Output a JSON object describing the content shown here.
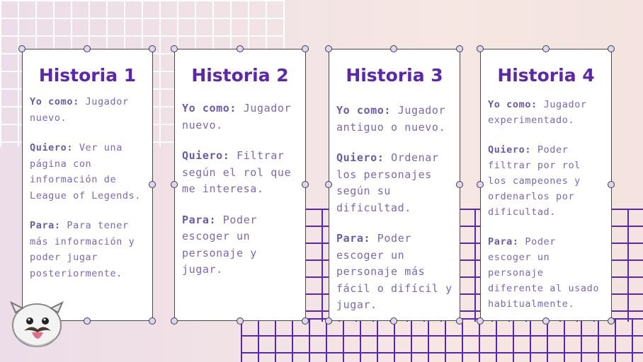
{
  "cards": [
    {
      "title": "Historia 1",
      "yo_label": "Yo como:",
      "yo_text": "Jugador nuevo.",
      "quiero_label": "Quiero:",
      "quiero_text": "Ver una página con información de League of Legends.",
      "para_label": "Para:",
      "para_text": "Para tener más información y poder jugar posteriormente."
    },
    {
      "title": "Historia 2",
      "yo_label": "Yo como:",
      "yo_text": "Jugador nuevo.",
      "quiero_label": "Quiero:",
      "quiero_text": "Filtrar según el rol que me interesa.",
      "para_label": "Para:",
      "para_text": "Poder escoger un personaje y jugar."
    },
    {
      "title": "Historia 3",
      "yo_label": "Yo como:",
      "yo_text": "Jugador antiguo o nuevo.",
      "quiero_label": "Quiero:",
      "quiero_text": "Ordenar los personajes según su dificultad.",
      "para_label": "Para:",
      "para_text": "Poder escoger un personaje más fácil o difícil y jugar."
    },
    {
      "title": "Historia 4",
      "yo_label": "Yo como:",
      "yo_text": "Jugador experimentado.",
      "quiero_label": "Quiero:",
      "quiero_text": "Poder filtrar por rol los campeones y ordenarlos por dificultad.",
      "para_label": "Para:",
      "para_text": "Poder escoger un personaje diferente al usado habitualmente."
    }
  ],
  "colors": {
    "title": "#5b27b0",
    "text": "#7b68b0",
    "grid": "#5b27b0"
  },
  "mascot_icon": "poro-mascot-icon"
}
